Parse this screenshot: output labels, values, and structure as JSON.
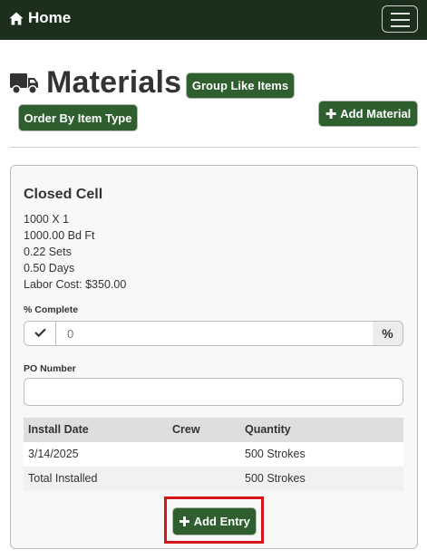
{
  "navbar": {
    "home_label": "Home",
    "home_icon": "home-icon",
    "menu_icon": "hamburger-menu-icon",
    "background_color": "#1c2e1c"
  },
  "header": {
    "title": "Materials",
    "title_icon": "truck-icon",
    "group_button": "Group Like Items",
    "order_button": "Order By Item Type",
    "add_material_button": "Add Material",
    "button_color": "#2f5e2f"
  },
  "material": {
    "name": "Closed Cell",
    "details": [
      "1000 X 1",
      "1000.00 Bd Ft",
      "0.22 Sets",
      "0.50 Days",
      "Labor Cost: $350.00"
    ],
    "percent_complete": {
      "label": "% Complete",
      "placeholder": "0",
      "suffix": "%",
      "check_icon": "check-icon"
    },
    "po_number": {
      "label": "PO Number",
      "value": ""
    },
    "install_table": {
      "columns": [
        "Install Date",
        "Crew",
        "Quantity"
      ],
      "rows": [
        [
          "3/14/2025",
          "",
          "500 Strokes"
        ],
        [
          "Total Installed",
          "",
          "500 Strokes"
        ]
      ]
    },
    "add_entry_button": "Add Entry",
    "highlight_color": "#d6151a"
  }
}
